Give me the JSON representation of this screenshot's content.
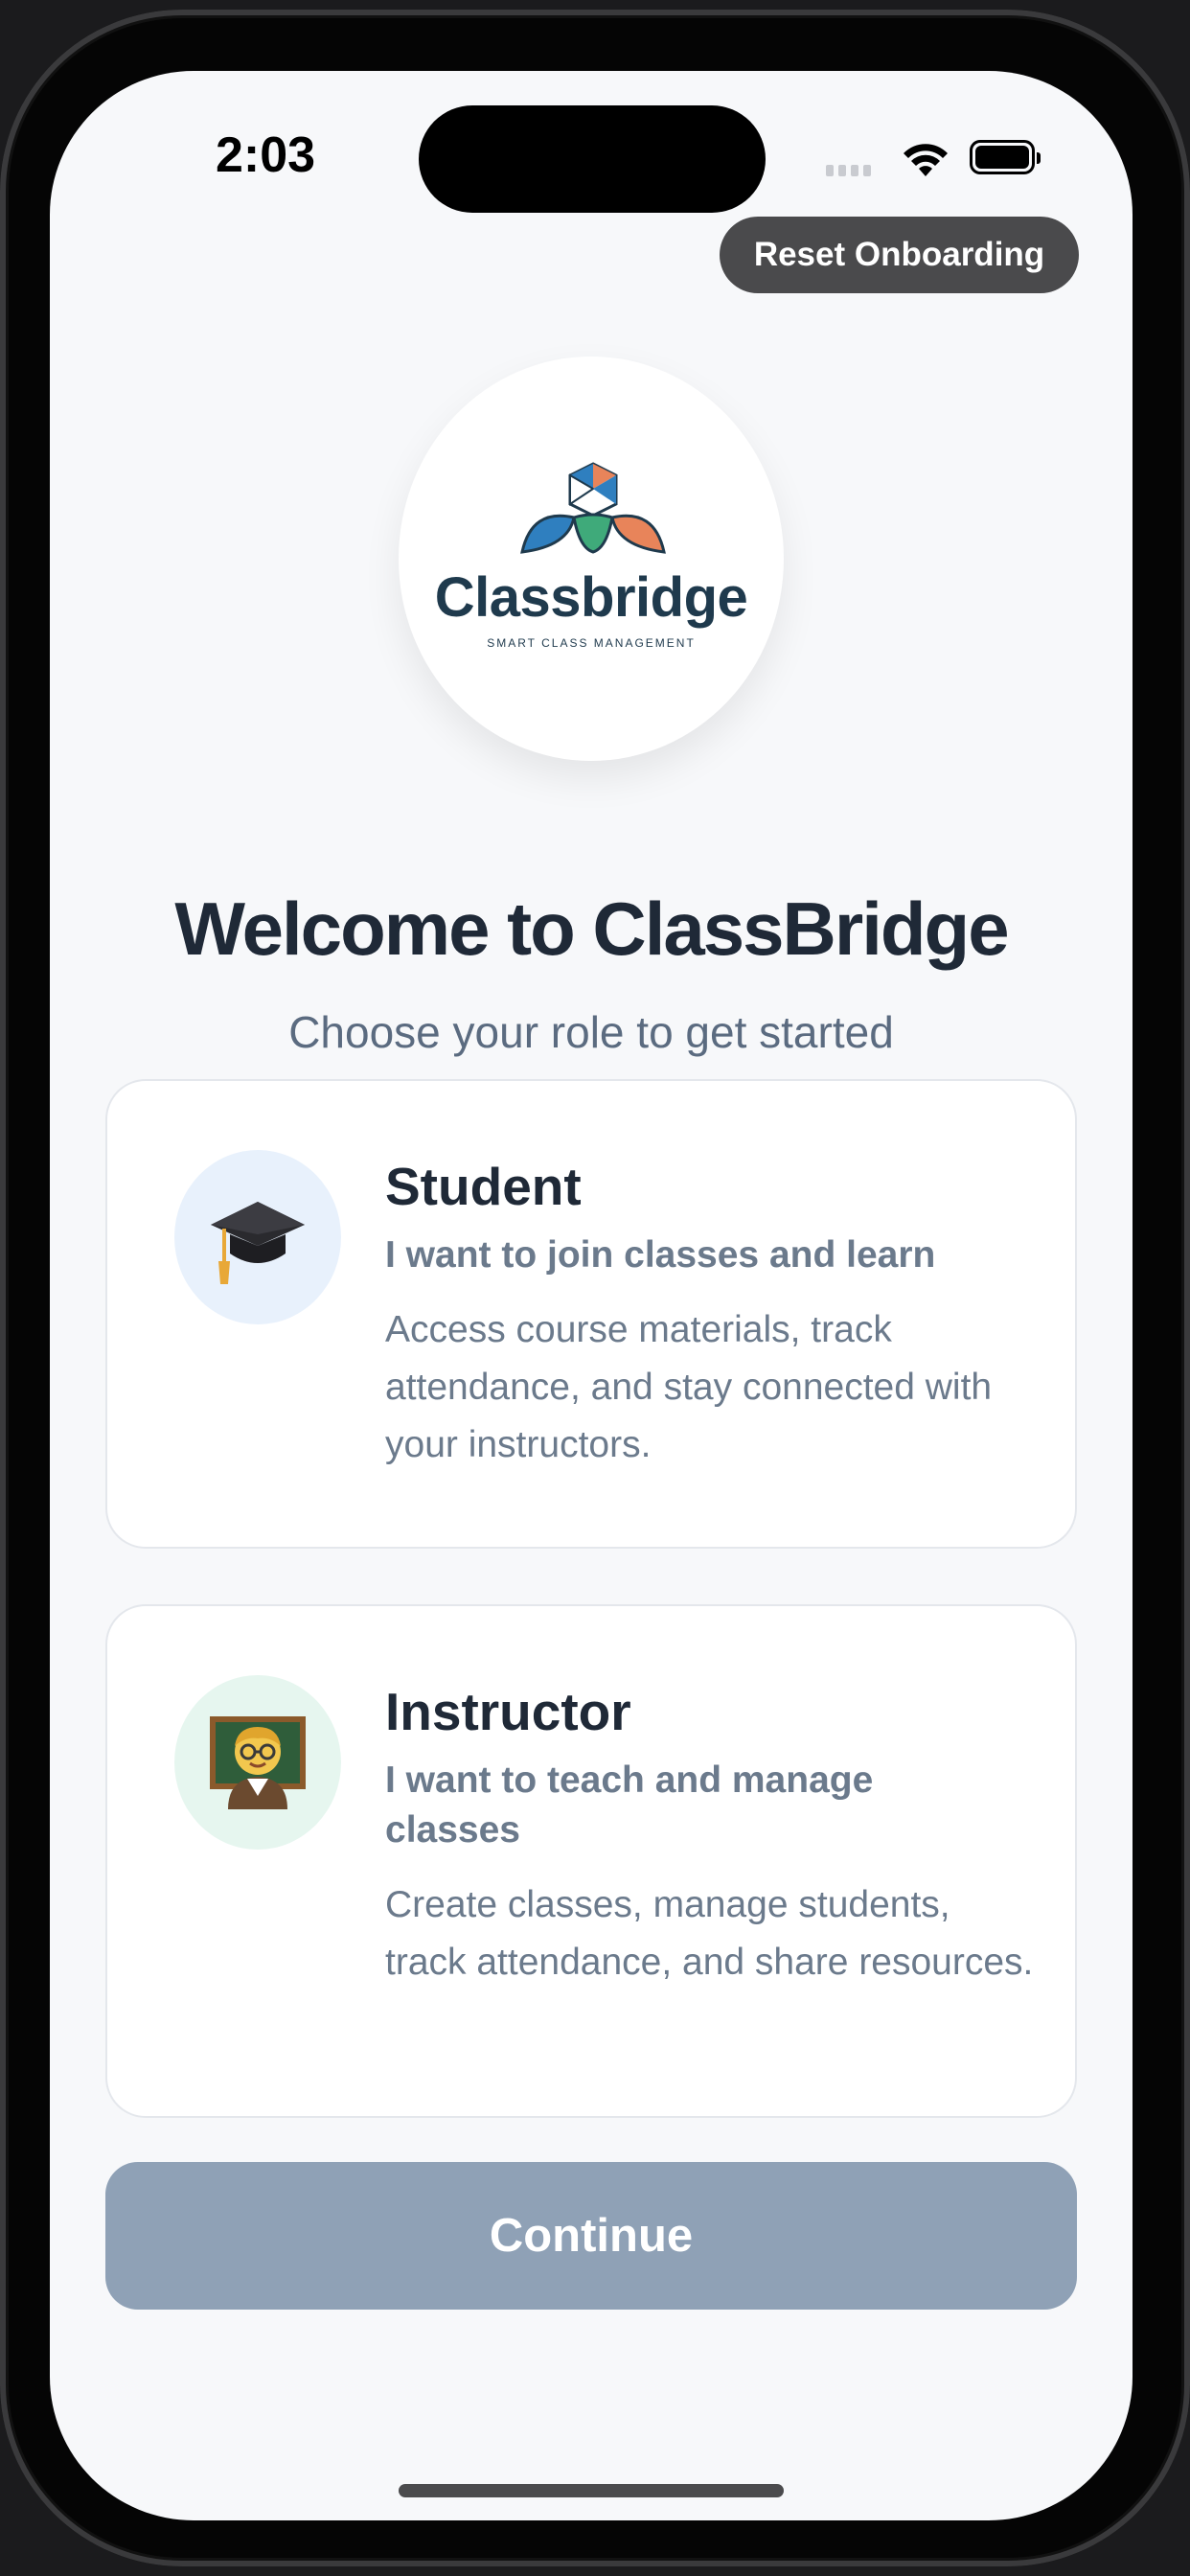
{
  "status_bar": {
    "time": "2:03"
  },
  "header": {
    "reset_label": "Reset Onboarding"
  },
  "logo": {
    "name": "Classbridge",
    "tagline": "SMART CLASS MANAGEMENT"
  },
  "welcome": {
    "title": "Welcome to ClassBridge",
    "subtitle": "Choose your role to get started"
  },
  "roles": [
    {
      "title": "Student",
      "lead": "I want to join classes and learn",
      "description": "Access course materials, track attendance, and stay connected with your instructors.",
      "icon": "graduation-cap-icon"
    },
    {
      "title": "Instructor",
      "lead": "I want to teach and manage classes",
      "description": "Create classes, manage students, track attendance, and share resources.",
      "icon": "teacher-icon"
    }
  ],
  "actions": {
    "continue_label": "Continue",
    "continue_enabled": false
  },
  "colors": {
    "background": "#f7f8fa",
    "title": "#1f2937",
    "muted": "#6b7a8c",
    "continue_disabled": "#8fa1b6",
    "student_avatar_bg": "#e8f1fc",
    "instructor_avatar_bg": "#e6f6ef"
  }
}
